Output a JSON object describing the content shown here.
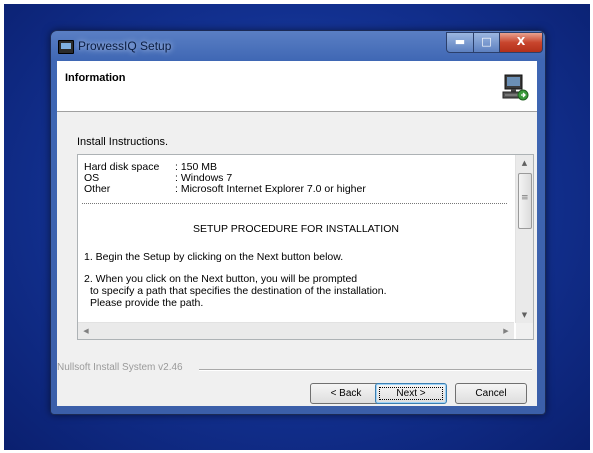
{
  "window": {
    "title": "ProwessIQ Setup",
    "caption_min": "▬",
    "caption_max": "□",
    "caption_close": "X"
  },
  "header": {
    "title": "Information",
    "icon": "computer-install-icon"
  },
  "instructions_label": "Install Instructions.",
  "requirements": [
    {
      "key": "Hard disk space",
      "value": ": 150 MB"
    },
    {
      "key": "OS",
      "value": ": Windows 7"
    },
    {
      "key": "Other",
      "value": ": Microsoft Internet Explorer 7.0 or higher"
    }
  ],
  "procedure_title": "SETUP PROCEDURE FOR INSTALLATION",
  "step1": "1. Begin the Setup by clicking on the Next button below.",
  "step2": {
    "line1": "2. When you click on the Next button, you will be prompted",
    "line2": "to specify a path that specifies the destination of the installation.",
    "line3": "Please provide the path."
  },
  "footer": {
    "branding": "Nullsoft Install System v2.46"
  },
  "buttons": {
    "back": "< Back",
    "next": "Next >",
    "cancel": "Cancel"
  },
  "colors": {
    "desktop": "#12308f",
    "titlebar": "#3f67b4",
    "close": "#c8452d"
  }
}
